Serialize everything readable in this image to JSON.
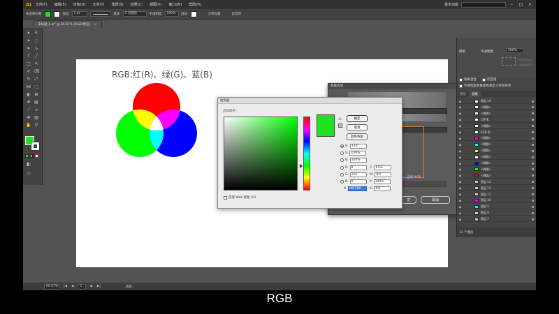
{
  "menubar": {
    "logo": "Ai",
    "items": [
      "文件(F)",
      "编辑(E)",
      "对象(O)",
      "文字(T)",
      "选择(S)",
      "效果(C)",
      "视图(V)",
      "窗口(W)",
      "帮助(H)"
    ],
    "workspace": "基本功能"
  },
  "control_bar": {
    "label": "未选择对象",
    "stroke_label": "描边",
    "stroke_weight": "1 pt",
    "brush_label": "基本",
    "points_label": "5 点圆形",
    "opacity_label": "不透明度",
    "opacity_value": "100%",
    "style_label": "样式",
    "doc_setup": "文档设置",
    "prefs": "首选项"
  },
  "document_tab": {
    "title": "未标题-1.ai* @ 66.67% (RGB/预览)",
    "close": "×"
  },
  "artboard": {
    "heading": "RGB:红(R)、绿(G)、蓝(B)"
  },
  "venn_colors": {
    "red": "#ff0000",
    "green": "#00ff00",
    "blue": "#0000ff",
    "yellow": "#ffff00",
    "magenta": "#ff00ff",
    "cyan": "#00ffff",
    "white": "#ffffff"
  },
  "color_picker": {
    "title": "拾色器",
    "select_label": "选择颜色：",
    "current_color": "#1ee31e",
    "ok": "确定",
    "cancel": "取消",
    "swatches": "颜色色板",
    "fields": {
      "h_label": "H:",
      "h_value": "120°",
      "s_label": "S:",
      "s_value": "100%",
      "b_label": "B:",
      "b_value": "100%",
      "r_label": "R:",
      "r_value": "0",
      "g_label": "G:",
      "g_value": "255",
      "bl_label": "B:",
      "bl_value": "0",
      "c_label": "C:",
      "c_value": "61%",
      "m_label": "M:",
      "m_value": "0%",
      "y_label": "Y:",
      "y_value": "100%",
      "k_label": "K:",
      "k_value": "0%",
      "hex_label": "#",
      "hex_value": "00FF00"
    },
    "only_web": "仅限 Web 颜色 (O)"
  },
  "swatch_options": {
    "title": "色板选项",
    "global_rgb": "全局 RGB",
    "ok": "定",
    "cancel": "取消"
  },
  "right_panel": {
    "color_label": "颜色",
    "opacity_label": "不透明度",
    "opacity_value": "100%",
    "options": [
      "隔离混合",
      "挖空组",
      "不透明度和蒙版用来定义挖空形状"
    ],
    "tabs": [
      "图层",
      "画板"
    ],
    "layers": [
      {
        "name": "图层 14",
        "color": "#ffffff"
      },
      {
        "name": "<椭圆>",
        "color": "#ffffff"
      },
      {
        "name": "<椭圆>",
        "color": "#ffffff"
      },
      {
        "name": "CMYK",
        "color": "#ffffff"
      },
      {
        "name": "<椭圆>",
        "color": "#ffffff"
      },
      {
        "name": "RGB 色",
        "color": "#ffffff"
      },
      {
        "name": "<椭圆>",
        "color": "#ff00ff"
      },
      {
        "name": "<椭圆>",
        "color": "#00ffff"
      },
      {
        "name": "<椭圆>",
        "color": "#ffff00"
      },
      {
        "name": "<椭圆>",
        "color": "#ffffff"
      },
      {
        "name": "<椭圆>",
        "color": "#0000ff"
      },
      {
        "name": "<椭圆>",
        "color": "#00ff00"
      },
      {
        "name": "<椭圆>",
        "color": "#ff0000"
      },
      {
        "name": "图层 13",
        "color": "#cccccc"
      },
      {
        "name": "图层 12",
        "color": "#cccccc"
      },
      {
        "name": "图层 11",
        "color": "#cccccc"
      },
      {
        "name": "图层 10",
        "color": "#ff00ff"
      },
      {
        "name": "图层 9",
        "color": "#00ffff"
      },
      {
        "name": "图层 8",
        "color": "#cccccc"
      },
      {
        "name": "图层 7",
        "color": "#cccccc"
      }
    ],
    "footer": "14 个图层"
  },
  "status_bar": {
    "zoom": "66.67%",
    "page": "1",
    "tool": "选择"
  },
  "subtitle": "RGB"
}
